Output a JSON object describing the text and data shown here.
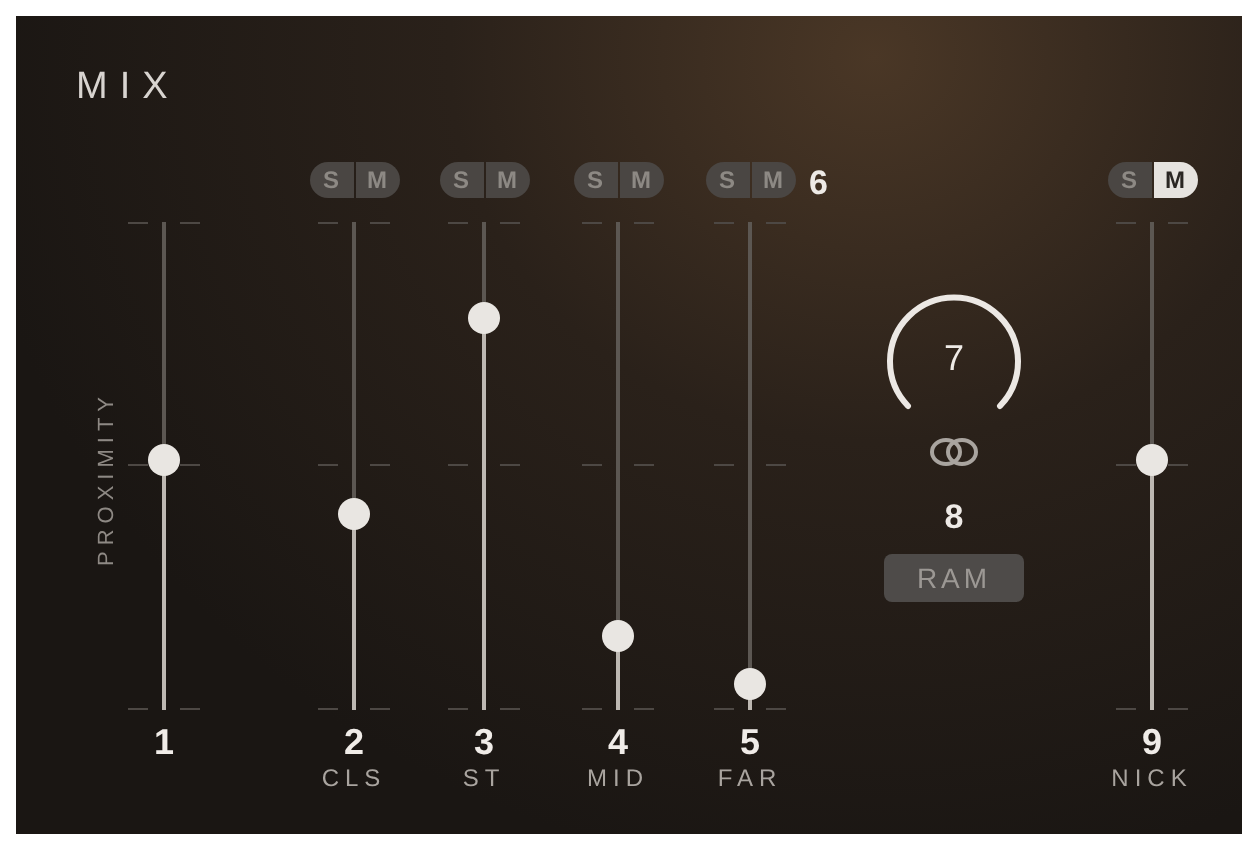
{
  "title": "MIX",
  "side_label": "PROXIMITY",
  "channels": [
    {
      "kind": "plain",
      "number": "1",
      "level": 0.51
    },
    {
      "kind": "strip",
      "number": "2",
      "label": "CLS",
      "level": 0.4,
      "solo": {
        "label": "S",
        "on": false
      },
      "mute": {
        "label": "M",
        "on": false
      }
    },
    {
      "kind": "strip",
      "number": "3",
      "label": "ST",
      "level": 0.8,
      "solo": {
        "label": "S",
        "on": false
      },
      "mute": {
        "label": "M",
        "on": false
      }
    },
    {
      "kind": "strip",
      "number": "4",
      "label": "MID",
      "level": 0.15,
      "solo": {
        "label": "S",
        "on": false
      },
      "mute": {
        "label": "M",
        "on": false
      }
    },
    {
      "kind": "strip",
      "number": "5",
      "label": "FAR",
      "level": 0.05,
      "solo": {
        "label": "S",
        "on": false
      },
      "mute": {
        "label": "M",
        "on": false
      },
      "tag": "6"
    },
    {
      "kind": "center",
      "knob_value": "7",
      "value": "8",
      "button": "RAM"
    },
    {
      "kind": "strip",
      "number": "9",
      "label": "NICK",
      "level": 0.51,
      "solo": {
        "label": "S",
        "on": false
      },
      "mute": {
        "label": "M",
        "on": true
      }
    }
  ]
}
